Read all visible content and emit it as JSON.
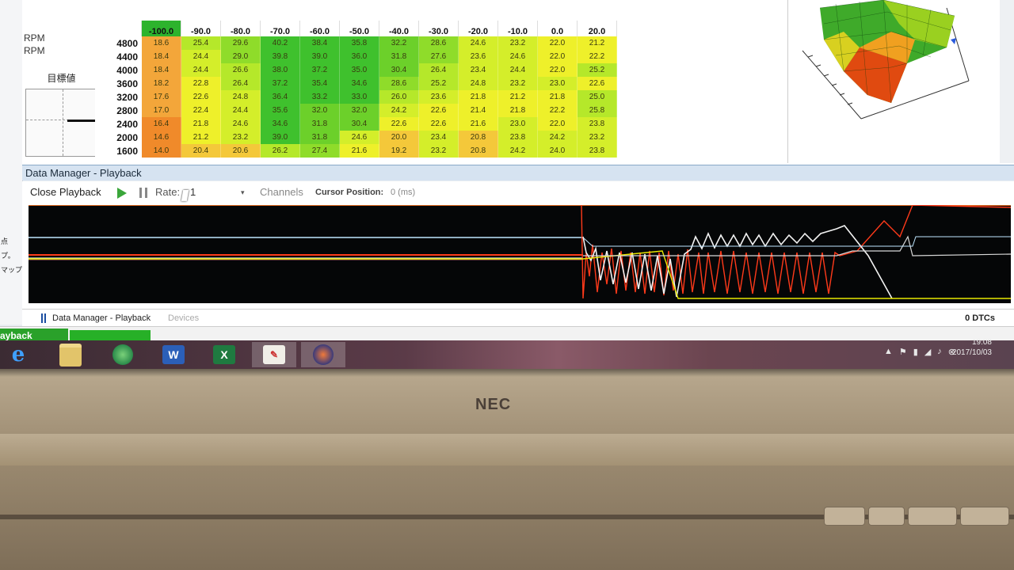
{
  "left_strip": {
    "items": [
      "点",
      "プ。",
      "マップ"
    ]
  },
  "map_table": {
    "side_label_1": "RPM",
    "side_label_2": "RPM",
    "target_label": "目標値",
    "columns": [
      "-100.0",
      "-90.0",
      "-80.0",
      "-70.0",
      "-60.0",
      "-50.0",
      "-40.0",
      "-30.0",
      "-20.0",
      "-10.0",
      "0.0",
      "20.0"
    ],
    "rows": [
      {
        "rpm": "4800",
        "values": [
          "18.6",
          "25.4",
          "29.6",
          "40.2",
          "38.4",
          "35.8",
          "32.2",
          "28.6",
          "24.6",
          "23.2",
          "22.0",
          "21.2"
        ]
      },
      {
        "rpm": "4400",
        "values": [
          "18.4",
          "24.4",
          "29.0",
          "39.8",
          "39.0",
          "36.0",
          "31.8",
          "27.6",
          "23.6",
          "24.6",
          "22.0",
          "22.2"
        ]
      },
      {
        "rpm": "4000",
        "values": [
          "18.4",
          "24.4",
          "26.6",
          "38.0",
          "37.2",
          "35.0",
          "30.4",
          "26.4",
          "23.4",
          "24.4",
          "22.0",
          "25.2"
        ]
      },
      {
        "rpm": "3600",
        "values": [
          "18.2",
          "22.8",
          "26.4",
          "37.2",
          "35.4",
          "34.6",
          "28.6",
          "25.2",
          "24.8",
          "23.2",
          "23.0",
          "22.6"
        ]
      },
      {
        "rpm": "3200",
        "values": [
          "17.6",
          "22.6",
          "24.8",
          "36.4",
          "33.2",
          "33.0",
          "26.0",
          "23.6",
          "21.8",
          "21.2",
          "21.8",
          "25.0"
        ]
      },
      {
        "rpm": "2800",
        "values": [
          "17.0",
          "22.4",
          "24.4",
          "35.6",
          "32.0",
          "32.0",
          "24.2",
          "22.6",
          "21.4",
          "21.8",
          "22.2",
          "25.8"
        ]
      },
      {
        "rpm": "2400",
        "values": [
          "16.4",
          "21.8",
          "24.6",
          "34.6",
          "31.8",
          "30.4",
          "22.6",
          "22.6",
          "21.6",
          "23.0",
          "22.0",
          "23.8"
        ]
      },
      {
        "rpm": "2000",
        "values": [
          "14.6",
          "21.2",
          "23.2",
          "39.0",
          "31.8",
          "24.6",
          "20.0",
          "23.4",
          "20.8",
          "23.8",
          "24.2",
          "23.2"
        ]
      },
      {
        "rpm": "1600",
        "values": [
          "14.0",
          "20.4",
          "20.6",
          "26.2",
          "27.4",
          "21.6",
          "19.2",
          "23.2",
          "20.8",
          "24.2",
          "24.0",
          "23.8"
        ]
      }
    ]
  },
  "data_manager": {
    "title": "Data Manager - Playback",
    "close_label": "Close Playback",
    "rate_label": "Rate:",
    "rate_value": "1",
    "channels_label": "Channels",
    "cursor_label": "Cursor Position:",
    "cursor_value": "0  (ms)",
    "tab_label": "Data Manager - Playback",
    "devices_label": "Devices",
    "dtc_label": "0 DTCs"
  },
  "status": {
    "label": "ayback",
    "progress": 1.0
  },
  "taskbar": {
    "icons": [
      "ie-icon",
      "file-explorer-icon",
      "app-icon",
      "word-icon",
      "excel-icon",
      "paint-icon",
      "tuner-app-icon"
    ],
    "word_letter": "W",
    "excel_letter": "X"
  },
  "clock": {
    "time": "19:08",
    "date": "2017/10/03"
  },
  "laptop": {
    "brand": "NEC"
  },
  "colors": {
    "green": "#2db32d",
    "orange": "#f39a2a",
    "yellow": "#f1f02a",
    "trace_red": "#ff3a1a",
    "trace_white": "#f2f2f2",
    "trace_yellow": "#e8e800",
    "trace_cyan": "#bfe7ff"
  }
}
